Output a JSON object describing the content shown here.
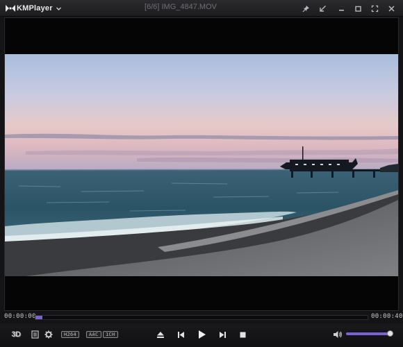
{
  "app": {
    "brand": "KMPlayer",
    "window_title": "[6/6] IMG_4847.MOV"
  },
  "titlebar_buttons": [
    "pin-icon",
    "minimize-to-corner-icon",
    "minimize-icon",
    "maximize-icon",
    "fullscreen-icon",
    "close-icon"
  ],
  "playback": {
    "current_time": "00:00:00",
    "remaining_time": "00:00:40",
    "progress": 0.0
  },
  "controls": {
    "threed_label": "3D",
    "codecs": [
      "H264",
      "AAC",
      "1CH"
    ],
    "buttons": [
      "playlist-icon",
      "settings-icon",
      "eject-icon",
      "previous-icon",
      "play-icon",
      "next-icon",
      "stop-icon",
      "volume-icon"
    ],
    "volume_level": 0.92
  },
  "colors": {
    "accent": "#7b62d6",
    "background": "#141416"
  }
}
